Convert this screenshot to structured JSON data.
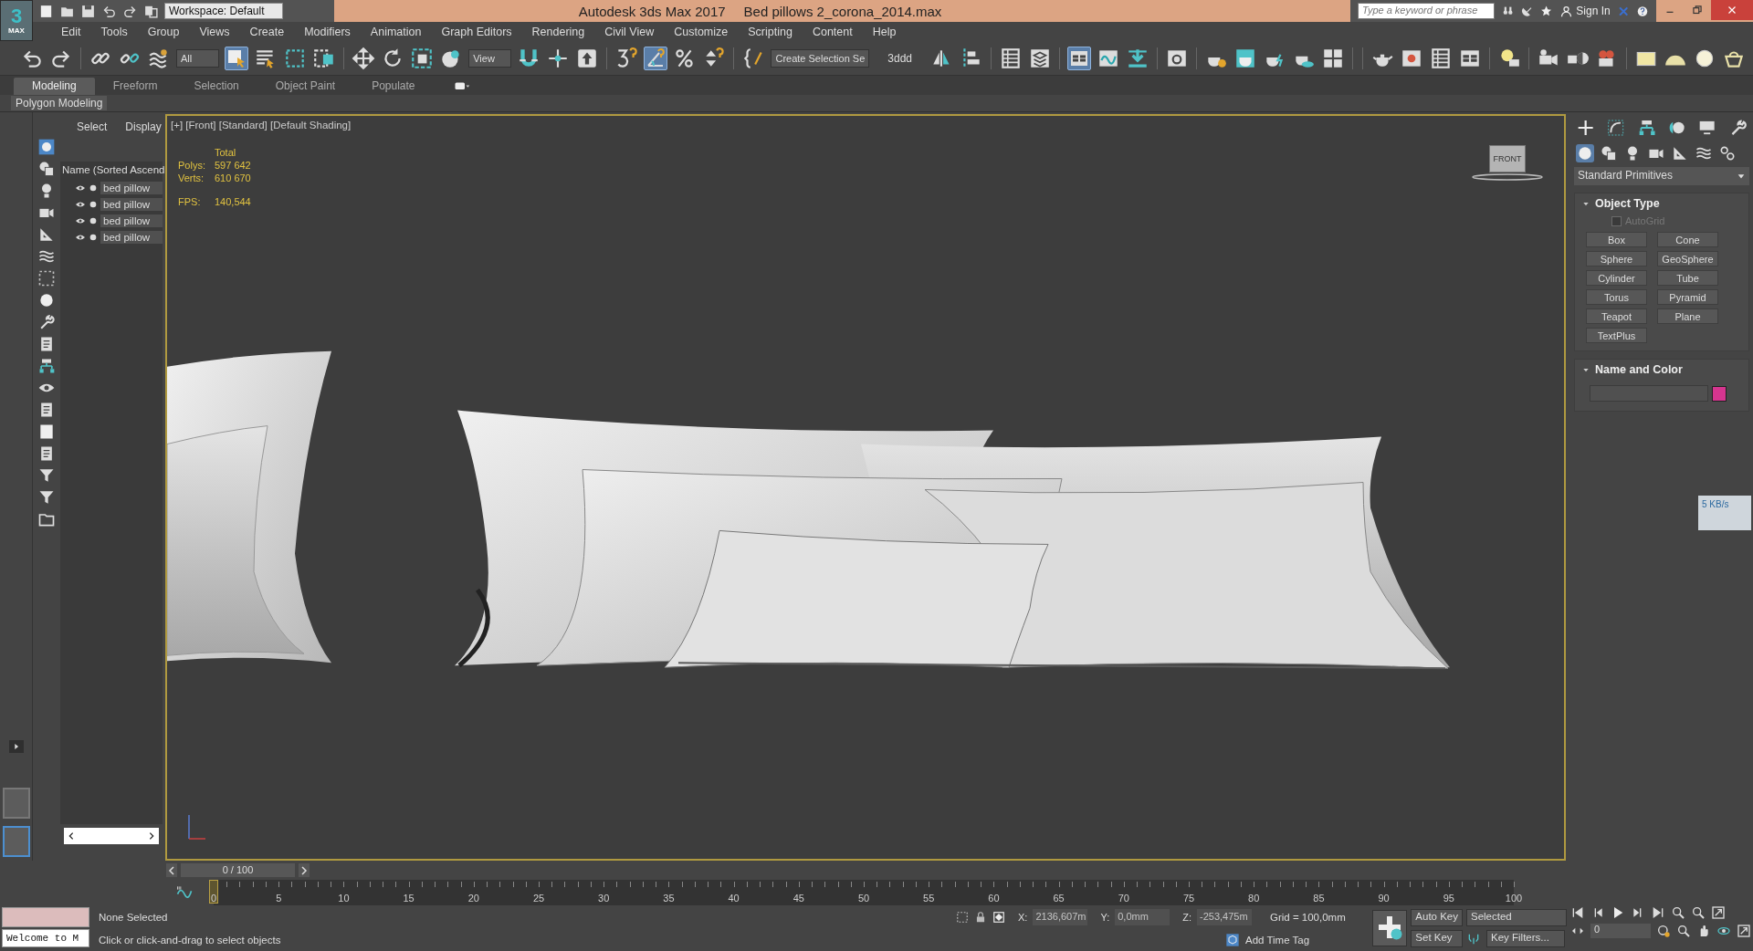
{
  "logo": {
    "mark": "3",
    "label": "MAX"
  },
  "window": {
    "workspace": "Workspace: Default",
    "app_title": "Autodesk 3ds Max 2017",
    "file_title": "Bed pillows 2_corona_2014.max"
  },
  "search": {
    "placeholder": "Type a keyword or phrase"
  },
  "sign_in": "Sign In",
  "menus": [
    "Edit",
    "Tools",
    "Group",
    "Views",
    "Create",
    "Modifiers",
    "Animation",
    "Graph Editors",
    "Rendering",
    "Civil View",
    "Customize",
    "Scripting",
    "Content",
    "Help"
  ],
  "toolbar": {
    "selection_filter": "All",
    "reference_coordinate": "View",
    "named_selection": "Create Selection Se",
    "plugin_label": "3ddd"
  },
  "ribbon": {
    "tabs": [
      {
        "label": "Modeling",
        "selected": true
      },
      {
        "label": "Freeform",
        "selected": false
      },
      {
        "label": "Selection",
        "selected": false
      },
      {
        "label": "Object Paint",
        "selected": false
      },
      {
        "label": "Populate",
        "selected": false
      }
    ],
    "panel": "Polygon Modeling"
  },
  "scene_explorer": {
    "tabs": [
      "Select",
      "Display"
    ],
    "column": "Name (Sorted Ascend",
    "items": [
      {
        "name": "bed pillow"
      },
      {
        "name": "bed pillow"
      },
      {
        "name": "bed pillow"
      },
      {
        "name": "bed pillow"
      }
    ]
  },
  "viewport": {
    "label": "[+] [Front] [Standard] [Default Shading]",
    "stats_heading": "Total",
    "stats": [
      {
        "label": "Polys:",
        "value": "597 642"
      },
      {
        "label": "Verts:",
        "value": "610 670"
      },
      {
        "label": "FPS:",
        "value": "140,544"
      }
    ],
    "viewcube": "FRONT"
  },
  "command_panel": {
    "category": "Standard Primitives",
    "object_type": {
      "title": "Object Type",
      "autogrid": {
        "label": "AutoGrid",
        "checked": false,
        "disabled": true
      },
      "buttons": [
        "Box",
        "Cone",
        "Sphere",
        "GeoSphere",
        "Cylinder",
        "Tube",
        "Torus",
        "Pyramid",
        "Teapot",
        "Plane",
        "TextPlus"
      ]
    },
    "name_and_color": {
      "title": "Name and Color",
      "color": "#d6358f"
    }
  },
  "network": {
    "speed": "5 KB/s"
  },
  "time_slider": {
    "position": "0 / 100"
  },
  "track_bar": {
    "labels": [
      "0",
      "5",
      "10",
      "15",
      "20",
      "25",
      "30",
      "35",
      "40",
      "45",
      "50",
      "55",
      "60",
      "65",
      "70",
      "75",
      "80",
      "85",
      "90",
      "95",
      "100"
    ]
  },
  "status": {
    "selection": "None Selected",
    "listener": "Welcome to M",
    "prompt": "Click or click-and-drag to select objects",
    "coords": [
      {
        "label": "X:",
        "value": "2136,607m"
      },
      {
        "label": "Y:",
        "value": "0,0mm"
      },
      {
        "label": "Z:",
        "value": "-253,475m"
      }
    ],
    "grid": "Grid = 100,0mm",
    "add_time_tag": "Add Time Tag",
    "auto_key": "Auto Key",
    "key_mode": "Selected",
    "set_key": "Set Key",
    "key_filters": "Key Filters...",
    "frame": "0"
  }
}
